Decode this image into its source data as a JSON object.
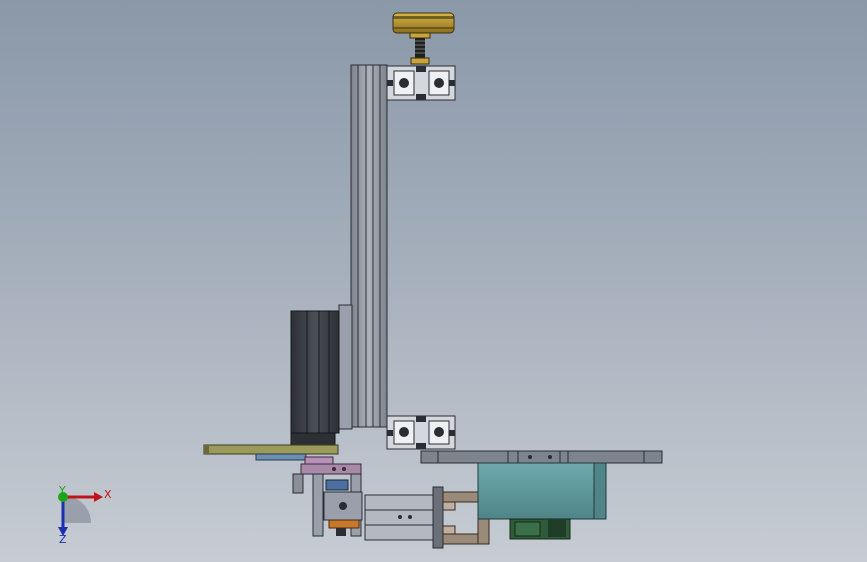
{
  "triad": {
    "x_label": "X",
    "y_label": "Y",
    "z_label": "Z",
    "x_color": "#c0141b",
    "y_color": "#1aa51a",
    "z_color": "#1b2fb0"
  },
  "colors": {
    "background_top": "#8a98a8",
    "background_bottom": "#c7ccd3",
    "aluminum_profile": "#9aa0ab",
    "steel_dark": "#3a3d42",
    "brass": "#b8942c",
    "cyan_body": "#5e9a9e",
    "dark_green": "#2f5b3a",
    "purple_bracket": "#a88aa8",
    "olive_plate": "#9a9a5a",
    "steel_blue": "#6a8fb0"
  }
}
